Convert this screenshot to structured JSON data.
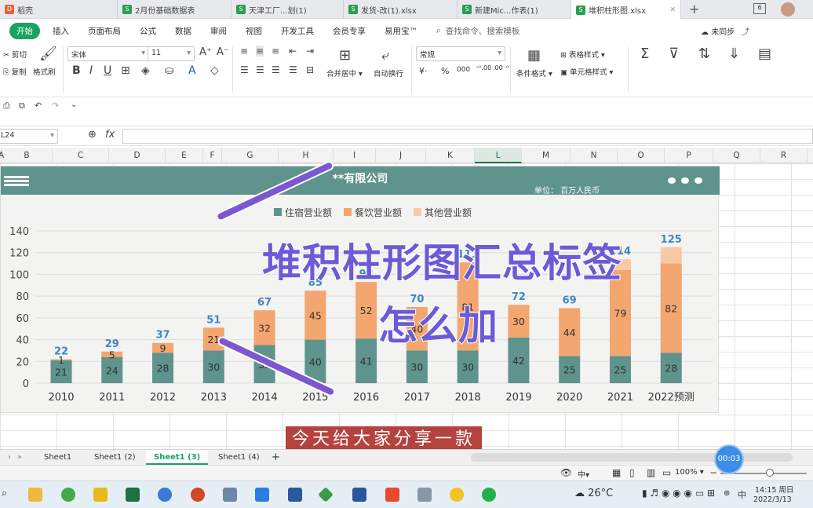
{
  "tabs": [
    {
      "label": "稻壳",
      "icon": "daoke-icon"
    },
    {
      "label": "2月份基础数据表",
      "icon": "sheet-icon"
    },
    {
      "label": "天津工厂...划(1)",
      "icon": "sheet-icon"
    },
    {
      "label": "发货-改(1).xlsx",
      "icon": "sheet-icon"
    },
    {
      "label": "新建Mic...作表(1)",
      "icon": "sheet-icon"
    },
    {
      "label": "堆积柱形图.xlsx",
      "icon": "sheet-icon"
    }
  ],
  "ribbon_tabs": [
    "开始",
    "插入",
    "页面布局",
    "公式",
    "数据",
    "审阅",
    "视图",
    "开发工具",
    "会员专享",
    "易用宝™"
  ],
  "search_placeholder": "查找命令、搜索模板",
  "sync_label": "未同步",
  "ribbon": {
    "cut": "剪切",
    "copy": "复制",
    "format_painter": "格式刷",
    "font_name": "宋体",
    "font_size": "11",
    "merge_center": "合并居中",
    "wrap": "自动换行",
    "number_format": "常规",
    "cond_format": "条件格式",
    "table_style": "表格样式",
    "cell_style": "单元格样式"
  },
  "name_box": "L24",
  "fx": "fx",
  "columns": [
    "A",
    "B",
    "C",
    "D",
    "E",
    "F",
    "G",
    "H",
    "I",
    "J",
    "K",
    "L",
    "M",
    "N",
    "O",
    "P",
    "Q",
    "R"
  ],
  "chart_data": {
    "type": "bar",
    "stacked": true,
    "title": "**有限公司",
    "unit": "单位：  百万人民币",
    "categories": [
      "2010",
      "2011",
      "2012",
      "2013",
      "2014",
      "2015",
      "2016",
      "2017",
      "2018",
      "2019",
      "2020",
      "2021",
      "2022预测"
    ],
    "series": [
      {
        "name": "住宿营业额",
        "color": "#5f938d",
        "values": [
          21,
          24,
          28,
          30,
          35,
          40,
          41,
          30,
          30,
          42,
          25,
          25,
          28
        ]
      },
      {
        "name": "餐饮营业额",
        "color": "#f3a66f",
        "values": [
          1,
          5,
          9,
          21,
          32,
          45,
          52,
          40,
          81,
          30,
          44,
          79,
          82
        ]
      },
      {
        "name": "其他营业额",
        "color": "#f8c9a5",
        "values": [
          0,
          0,
          0,
          0,
          0,
          0,
          0,
          0,
          0,
          0,
          0,
          10,
          15
        ]
      }
    ],
    "totals": [
      22,
      29,
      37,
      51,
      67,
      85,
      93,
      70,
      111,
      72,
      69,
      114,
      125
    ],
    "ylim": [
      0,
      140
    ],
    "yticks": [
      0,
      20,
      40,
      60,
      80,
      100,
      120,
      140
    ],
    "legend_position": "top"
  },
  "overlay": {
    "title_line1": "堆积柱形图汇总标签",
    "title_line2": "怎么加",
    "subtitle": "今天给大家分享一款",
    "timer": "00:03"
  },
  "sheets": [
    "Sheet1",
    "Sheet1 (2)",
    "Sheet1 (3)",
    "Sheet1 (4)"
  ],
  "zoom": "100%",
  "taskbar": {
    "weather": "26°C",
    "time": "14:15 周日",
    "date": "2022/3/13",
    "ime": "中"
  }
}
